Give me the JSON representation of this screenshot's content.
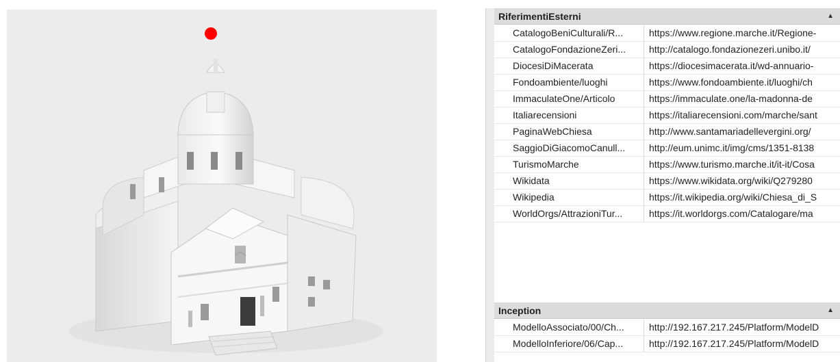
{
  "panel": {
    "sections": [
      {
        "title": "RiferimentiEsterni",
        "rows": [
          {
            "key": "CatalogoBeniCulturali/R...",
            "value": "https://www.regione.marche.it/Regione-"
          },
          {
            "key": "CatalogoFondazioneZeri...",
            "value": "http://catalogo.fondazionezeri.unibo.it/"
          },
          {
            "key": "DiocesiDiMacerata",
            "value": "https://diocesimacerata.it/wd-annuario-"
          },
          {
            "key": "Fondoambiente/luoghi",
            "value": "https://www.fondoambiente.it/luoghi/ch"
          },
          {
            "key": "ImmaculateOne/Articolo",
            "value": "https://immaculate.one/la-madonna-de"
          },
          {
            "key": "Italiarecensioni",
            "value": "https://italiarecensioni.com/marche/sant"
          },
          {
            "key": "PaginaWebChiesa",
            "value": "http://www.santamariadellevergini.org/"
          },
          {
            "key": "SaggioDiGiacomoCanull...",
            "value": "http://eum.unimc.it/img/cms/1351-8138"
          },
          {
            "key": "TurismoMarche",
            "value": "https://www.turismo.marche.it/it-it/Cosa"
          },
          {
            "key": "Wikidata",
            "value": "https://www.wikidata.org/wiki/Q279280"
          },
          {
            "key": "Wikipedia",
            "value": "https://it.wikipedia.org/wiki/Chiesa_di_S"
          },
          {
            "key": "WorldOrgs/AttrazioniTur...",
            "value": "https://it.worldorgs.com/Catalogare/ma"
          }
        ]
      },
      {
        "title": "Inception",
        "rows": [
          {
            "key": "ModelloAssociato/00/Ch...",
            "value": "http://192.167.217.245/Platform/ModelD"
          },
          {
            "key": "ModelloInferiore/06/Cap...",
            "value": "http://192.167.217.245/Platform/ModelD"
          }
        ]
      }
    ]
  },
  "icons": {
    "collapse": "chevron-up-icon",
    "marker": "red-dot-marker"
  },
  "colors": {
    "marker": "#ff0000",
    "header_bg": "#dcdcdc",
    "viewport_bg": "#ececec"
  }
}
